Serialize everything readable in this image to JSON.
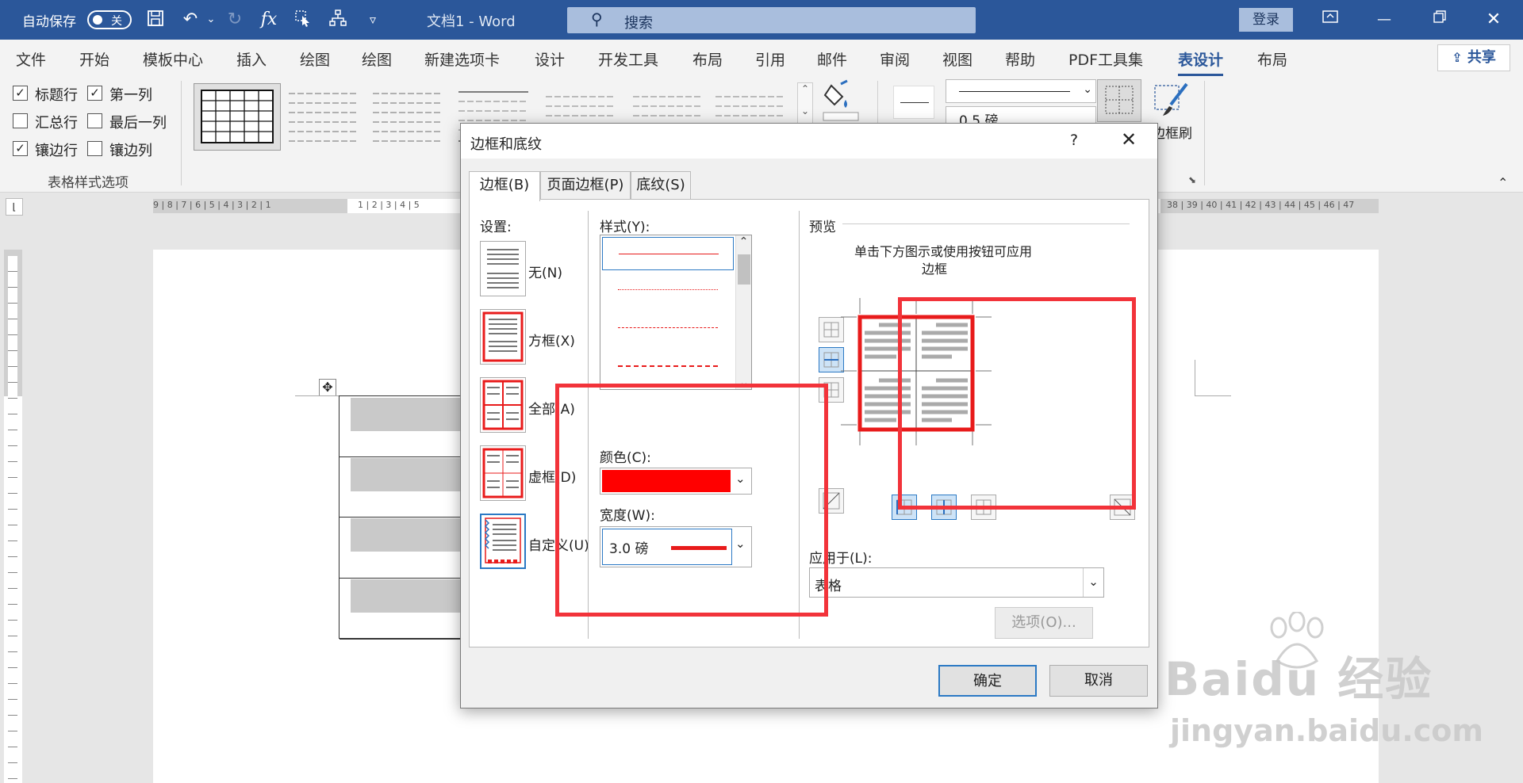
{
  "titlebar": {
    "autosave_label": "自动保存",
    "autosave_state": "关",
    "doc_title": "文档1  -  Word",
    "search_placeholder": "搜索",
    "login_label": "登录"
  },
  "menu": {
    "items": [
      "文件",
      "开始",
      "模板中心",
      "插入",
      "绘图",
      "绘图",
      "新建选项卡",
      "设计",
      "开发工具",
      "布局",
      "引用",
      "邮件",
      "审阅",
      "视图",
      "帮助",
      "PDF工具集",
      "表设计",
      "布局"
    ],
    "active_index": 16,
    "share_label": "共享"
  },
  "ribbon": {
    "options": [
      {
        "label": "标题行",
        "checked": true
      },
      {
        "label": "第一列",
        "checked": true
      },
      {
        "label": "汇总行",
        "checked": false
      },
      {
        "label": "最后一列",
        "checked": false
      },
      {
        "label": "镶边行",
        "checked": true
      },
      {
        "label": "镶边列",
        "checked": false
      }
    ],
    "group_label": "表格样式选项",
    "pen_weight": "0.5 磅",
    "border_painter_label": "边框刷"
  },
  "ruler": {
    "left_numbers": "9 | 8 | 7 | 6 | 5 | 4 | 3 | 2 | 1",
    "right_numbers": "1 | 2 | 3 | 4 | 5",
    "far_numbers": "38 | 39 | 40 | 41 | 42 | 43 | 44 | 45 | 46 | 47"
  },
  "dialog": {
    "title": "边框和底纹",
    "help": "?",
    "tabs": [
      "边框(B)",
      "页面边框(P)",
      "底纹(S)"
    ],
    "settings_label": "设置:",
    "settings": [
      "无(N)",
      "方框(X)",
      "全部(A)",
      "虚框(D)",
      "自定义(U)"
    ],
    "style_label": "样式(Y):",
    "color_label": "颜色(C):",
    "color_value": "#ff0000",
    "width_label": "宽度(W):",
    "width_value": "3.0 磅",
    "preview_label": "预览",
    "preview_hint_line1": "单击下方图示或使用按钮可应用",
    "preview_hint_line2": "边框",
    "apply_label": "应用于(L):",
    "apply_value": "表格",
    "options_button": "选项(O)...",
    "ok_button": "确定",
    "cancel_button": "取消"
  },
  "watermark": {
    "brand": "Baidu 经验",
    "url": "jingyan.baidu.com"
  }
}
